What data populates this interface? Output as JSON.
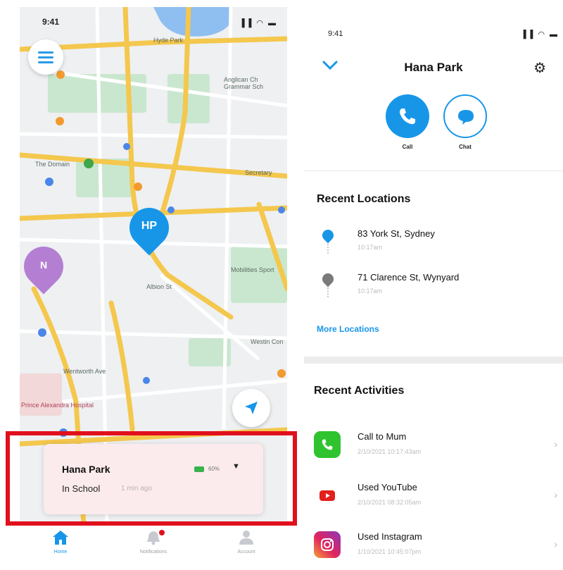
{
  "map_screen": {
    "status_time": "9:41",
    "status_icons": "▐▐ ◠ ▬",
    "labels": [
      "Hyde Park",
      "Anglican Ch Grammar Sch",
      "The Domain",
      "Secretary",
      "Westin Con",
      "Mobilities Sport",
      "Prince Alexandra Hospital",
      "Wentworth Ave",
      "Albion St"
    ],
    "pins": {
      "hp": "HP",
      "n": "N"
    },
    "card": {
      "name": "Hana Park",
      "battery_pct": "60%",
      "place": "In School",
      "ago": "1 min ago"
    },
    "tabs": [
      {
        "label": "Home"
      },
      {
        "label": "Notifications"
      },
      {
        "label": "Account"
      }
    ],
    "colors": {
      "accent": "#1796e8",
      "pin_n": "#b47fd3",
      "highlight": "#e0101c",
      "battery": "#37b24d"
    }
  },
  "profile_screen": {
    "status_time": "9:41",
    "status_icons": "▐▐ ◠ ▬",
    "title": "Hana Park",
    "actions": {
      "call": "Call",
      "chat": "Chat"
    },
    "recent_locations_title": "Recent Locations",
    "locations": [
      {
        "address": "83 York St, Sydney",
        "time": "10:17am",
        "pin_color": "#1796e8"
      },
      {
        "address": "71 Clarence St, Wynyard",
        "time": "10:17am",
        "pin_color": "#7a7a7a"
      }
    ],
    "more_locations": "More Locations",
    "recent_activities_title": "Recent Activities",
    "activities": [
      {
        "label": "Call to Mum",
        "time": "2/10/2021 10:17:43am",
        "icon": "phone-icon",
        "color": "#2fc42f"
      },
      {
        "label": "Used YouTube",
        "time": "2/10/2021 08:32:05am",
        "icon": "youtube-icon",
        "color": "#e2201c"
      },
      {
        "label": "Used Instagram",
        "time": "1/10/2021 10:45:07pm",
        "icon": "instagram-icon",
        "color": "#c13584"
      }
    ],
    "chevron": "›"
  }
}
